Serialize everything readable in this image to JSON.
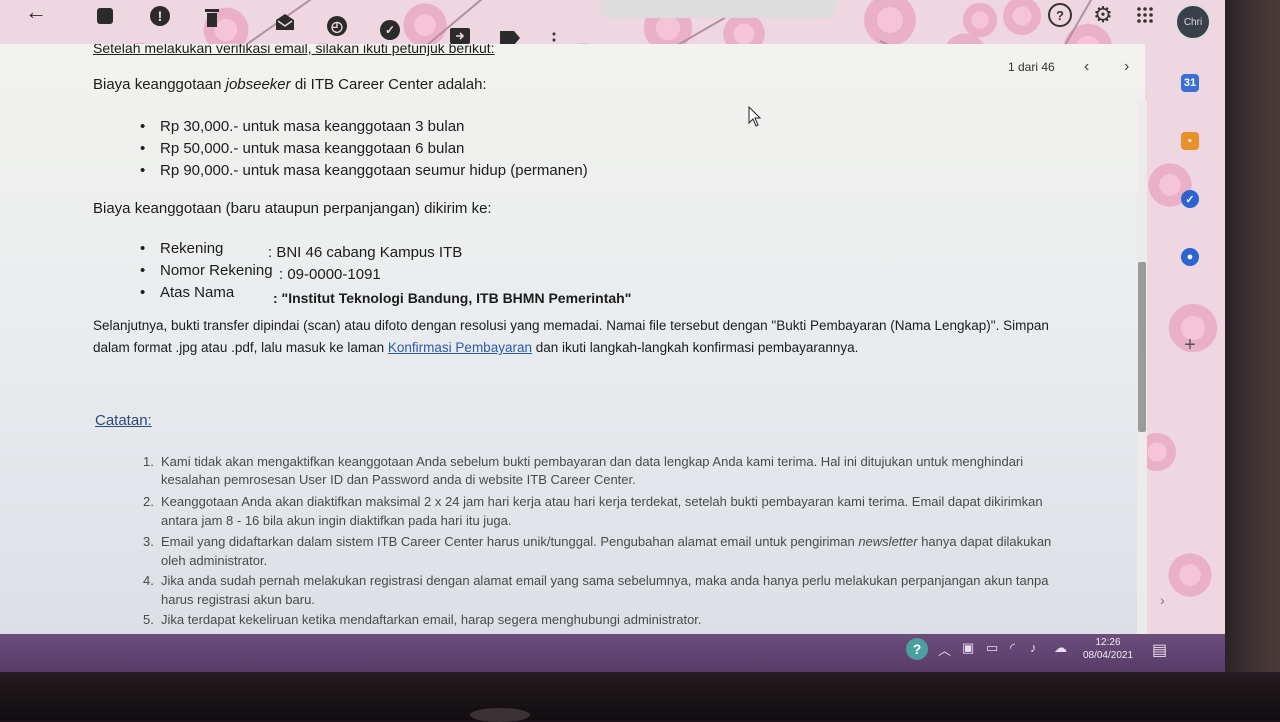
{
  "toolbar": {
    "back_label": "←",
    "more_label": "⋮"
  },
  "pager": {
    "text": "1 dari 46",
    "prev": "‹",
    "next": "›"
  },
  "top_right": {
    "help": "?",
    "settings": "⚙",
    "apps": "⋮⋮⋮",
    "avatar": "Chri"
  },
  "side_panel": {
    "calendar": "31",
    "plus": "+"
  },
  "email": {
    "intro": "Setelah melakukan verifikasi email, silakan ikuti petunjuk berikut:",
    "fee_prefix": "Biaya keanggotaan ",
    "fee_italic": "jobseeker",
    "fee_suffix": " di ITB Career Center adalah:",
    "fees": [
      "Rp 30,000.- untuk masa keanggotaan 3 bulan",
      "Rp 50,000.- untuk masa keanggotaan 6 bulan",
      "Rp 90,000.- untuk masa keanggotaan seumur hidup (permanen)"
    ],
    "send_to": "Biaya keanggotaan (baru ataupun perpanjangan) dikirim ke:",
    "bank": [
      {
        "label": "Rekening",
        "value": ": BNI 46 cabang Kampus ITB"
      },
      {
        "label": "Nomor Rekening",
        "value": ": 09-0000-1091"
      },
      {
        "label": "Atas Nama",
        "value": ": \"Institut Teknologi Bandung, ITB BHMN Pemerintah\""
      }
    ],
    "next_step_1": "Selanjutnya, bukti transfer dipindai (scan) atau difoto dengan resolusi yang memadai. Namai file tersebut dengan \"Bukti Pembayaran (Nama Lengkap)\". Simpan",
    "next_step_2_prefix": "dalam format .jpg atau .pdf, lalu masuk ke laman ",
    "next_step_link": "Konfirmasi Pembayaran",
    "next_step_2_suffix": " dan ikuti langkah-langkah konfirmasi pembayarannya.",
    "notes_title": "Catatan:",
    "notes": [
      {
        "n": "1.",
        "l1": "Kami tidak akan mengaktifkan keanggotaan Anda sebelum bukti pembayaran dan data lengkap Anda kami terima. Hal ini ditujukan untuk menghindari",
        "l2": "kesalahan pemrosesan User ID dan Password anda di website ITB Career Center."
      },
      {
        "n": "2.",
        "l1": "Keanggotaan Anda akan diaktifkan maksimal 2 x 24 jam hari kerja atau hari kerja terdekat, setelah bukti pembayaran kami terima. Email dapat dikirimkan",
        "l2": "antara jam 8 - 16 bila akun ingin diaktifkan pada hari itu juga."
      },
      {
        "n": "3.",
        "l1a": "Email yang didaftarkan dalam sistem ITB Career Center harus unik/tunggal. Pengubahan alamat email untuk pengiriman ",
        "l1i": "newsletter",
        "l1b": " hanya dapat dilakukan",
        "l2": "oleh administrator."
      },
      {
        "n": "4.",
        "l1": "Jika anda sudah pernah melakukan registrasi dengan alamat email yang sama sebelumnya, maka anda hanya perlu melakukan perpanjangan akun tanpa",
        "l2": "harus registrasi akun baru."
      },
      {
        "n": "5.",
        "l1": "Jika terdapat kekeliruan ketika mendaftarkan email, harap segera menghubungi administrator."
      }
    ]
  },
  "taskbar": {
    "time": "12:26",
    "date": "08/04/2021",
    "help": "?"
  }
}
